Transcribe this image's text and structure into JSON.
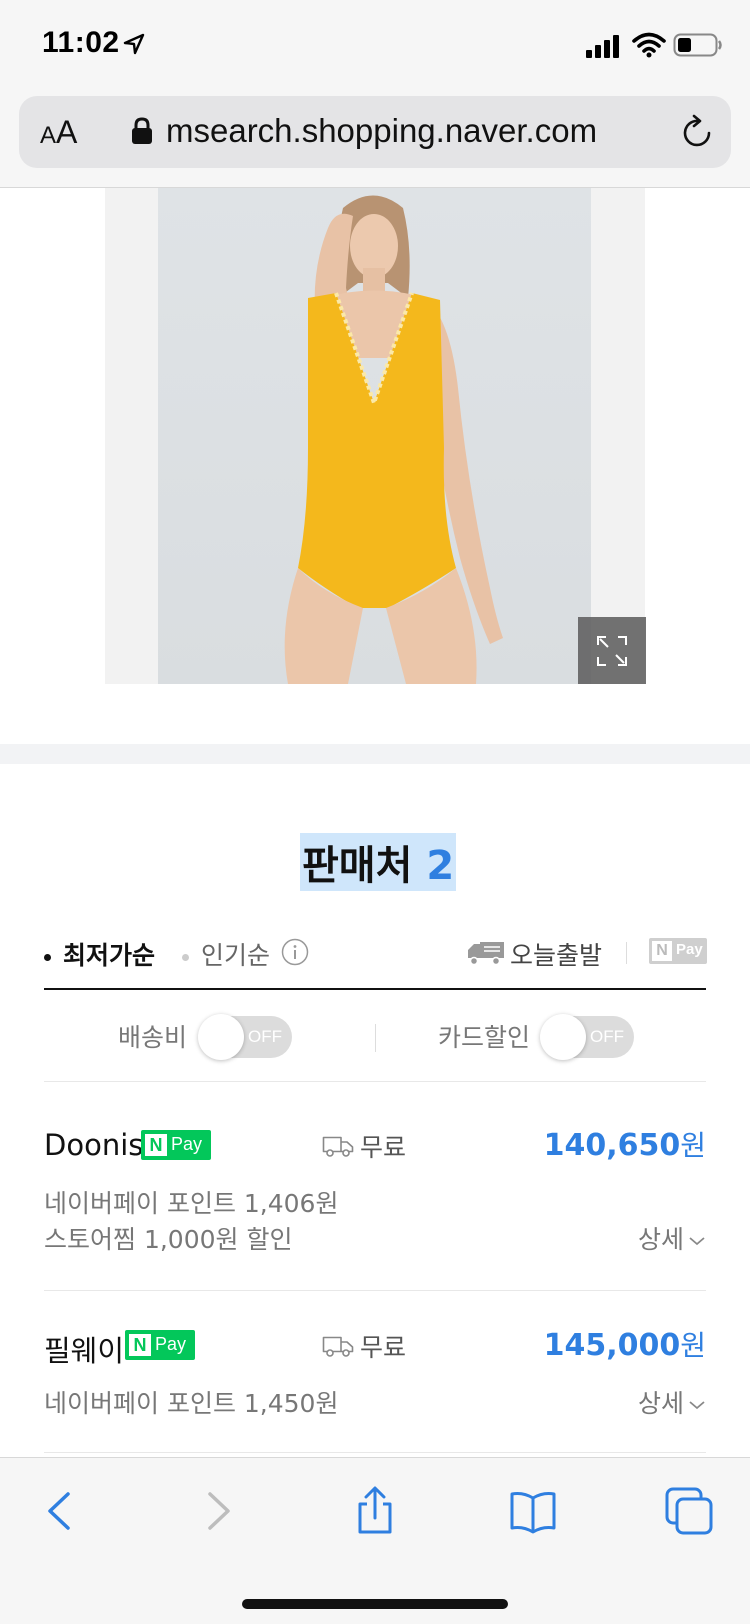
{
  "status_bar": {
    "time": "11:02",
    "icons": [
      "location-arrow-icon",
      "cellular-signal-icon",
      "wifi-icon",
      "battery-icon"
    ]
  },
  "browser": {
    "text_size_label_small": "A",
    "text_size_label_big": "A",
    "url": "msearch.shopping.naver.com",
    "icons": [
      "lock-icon",
      "reload-icon"
    ]
  },
  "product": {
    "image_alt": "yellow one-piece swimsuit model photo",
    "expand_icon": "expand-icon"
  },
  "sellers": {
    "title": "판매처",
    "count": "2",
    "sort": {
      "active": "최저가순",
      "inactive": "인기순",
      "today_shipping": "오늘출발",
      "npay_label_n": "N",
      "npay_label_pay": "Pay"
    },
    "filters": {
      "shipping_fee": "배송비",
      "card_discount": "카드할인",
      "off": "OFF"
    },
    "rows": [
      {
        "name": "Doonis",
        "npay_n": "N",
        "npay_pay": "Pay",
        "shipping": "무료",
        "price": "140,650",
        "unit": "원",
        "benefits": [
          "네이버페이 포인트 1,406원",
          "스토어찜 1,000원 할인"
        ],
        "detail": "상세"
      },
      {
        "name": "필웨이",
        "npay_n": "N",
        "npay_pay": "Pay",
        "shipping": "무료",
        "price": "145,000",
        "unit": "원",
        "benefits": [
          "네이버페이 포인트 1,450원"
        ],
        "detail": "상세"
      }
    ]
  },
  "colors": {
    "accent_blue": "#2f7fe0",
    "npay_green": "#03c75a",
    "title_highlight": "#cfe6fb",
    "swimsuit_yellow": "#f4b81c"
  },
  "toolbar": {
    "icons": [
      "back-icon",
      "forward-icon",
      "share-icon",
      "bookmarks-icon",
      "tabs-icon"
    ]
  }
}
